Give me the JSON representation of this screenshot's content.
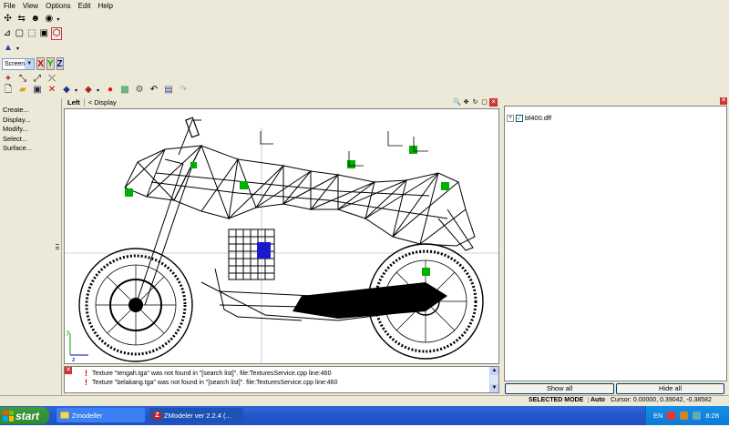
{
  "menu": [
    {
      "label": "File"
    },
    {
      "label": "View"
    },
    {
      "label": "Options"
    },
    {
      "label": "Edit"
    },
    {
      "label": "Help"
    }
  ],
  "toolbar": {
    "coord_system": "Screen",
    "axes": [
      "X",
      "Y",
      "Z"
    ]
  },
  "command_panel": {
    "items": [
      "Create...",
      "Display...",
      "Modify...",
      "Select...",
      "Surface..."
    ]
  },
  "viewport": {
    "name": "Left",
    "display_label": "< Display",
    "axis_labels": {
      "y": "y",
      "z": "z"
    }
  },
  "log": {
    "messages": [
      "Texture \"tengah.tga\" was not found in \"[search list]\". file:TexturesService.cpp line:460",
      "Texture \"belakang.tga\" was not found in \"[search list]\". file:TexturesService.cpp line:460"
    ]
  },
  "scene": {
    "root_item": "bf400.dff",
    "show_all": "Show all",
    "hide_all": "Hide all"
  },
  "status": {
    "mode": "SELECTED MODE",
    "auto": "Auto",
    "cursor": "Cursor: 0.00000, 0.39042, -0.38582"
  },
  "taskbar": {
    "start": "start",
    "tasks": [
      "Zmodeller",
      "ZModeler ver 2.2.4 (..."
    ],
    "lang": "EN",
    "clock": "8:28"
  },
  "colors": {
    "wire": "#000000",
    "handle": "#00b000",
    "selected": "#1a1acc",
    "taskbar": "#245edb",
    "start": "#3c9a3c"
  }
}
